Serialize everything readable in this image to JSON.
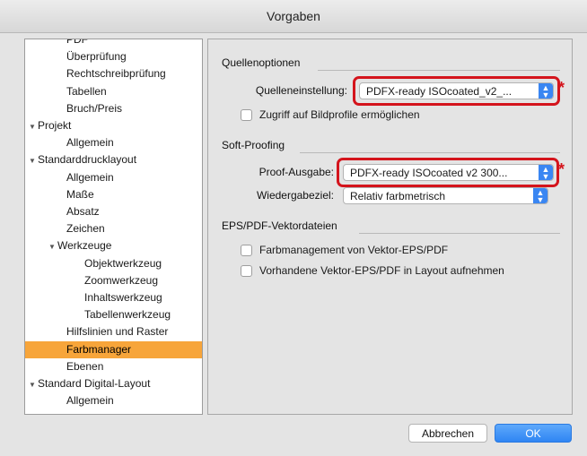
{
  "window": {
    "title": "Vorgaben"
  },
  "tree": {
    "items": [
      {
        "label": "PDF",
        "indent": 2,
        "collapsible": false,
        "selected": false
      },
      {
        "label": "Überprüfung",
        "indent": 2,
        "collapsible": false,
        "selected": false
      },
      {
        "label": "Rechtschreibprüfung",
        "indent": 2,
        "collapsible": false,
        "selected": false
      },
      {
        "label": "Tabellen",
        "indent": 2,
        "collapsible": false,
        "selected": false
      },
      {
        "label": "Bruch/Preis",
        "indent": 2,
        "collapsible": false,
        "selected": false
      },
      {
        "label": "Projekt",
        "indent": 0,
        "collapsible": true,
        "selected": false
      },
      {
        "label": "Allgemein",
        "indent": 2,
        "collapsible": false,
        "selected": false
      },
      {
        "label": "Standarddrucklayout",
        "indent": 0,
        "collapsible": true,
        "selected": false
      },
      {
        "label": "Allgemein",
        "indent": 2,
        "collapsible": false,
        "selected": false
      },
      {
        "label": "Maße",
        "indent": 2,
        "collapsible": false,
        "selected": false
      },
      {
        "label": "Absatz",
        "indent": 2,
        "collapsible": false,
        "selected": false
      },
      {
        "label": "Zeichen",
        "indent": 2,
        "collapsible": false,
        "selected": false
      },
      {
        "label": "Werkzeuge",
        "indent": 1,
        "collapsible": true,
        "selected": false
      },
      {
        "label": "Objektwerkzeug",
        "indent": 3,
        "collapsible": false,
        "selected": false
      },
      {
        "label": "Zoomwerkzeug",
        "indent": 3,
        "collapsible": false,
        "selected": false
      },
      {
        "label": "Inhaltswerkzeug",
        "indent": 3,
        "collapsible": false,
        "selected": false
      },
      {
        "label": "Tabellenwerkzeug",
        "indent": 3,
        "collapsible": false,
        "selected": false
      },
      {
        "label": "Hilfslinien und Raster",
        "indent": 2,
        "collapsible": false,
        "selected": false
      },
      {
        "label": "Farbmanager",
        "indent": 2,
        "collapsible": false,
        "selected": true
      },
      {
        "label": "Ebenen",
        "indent": 2,
        "collapsible": false,
        "selected": false
      },
      {
        "label": "Standard Digital-Layout",
        "indent": 0,
        "collapsible": true,
        "selected": false
      },
      {
        "label": "Allgemein",
        "indent": 2,
        "collapsible": false,
        "selected": false
      }
    ]
  },
  "sections": {
    "quelle": {
      "title": "Quellenoptionen",
      "einstellung_label": "Quelleneinstellung:",
      "einstellung_value": "PDFX-ready ISOcoated_v2_...",
      "bildprofile_label": "Zugriff auf Bildprofile ermöglichen",
      "bildprofile_checked": false
    },
    "softproof": {
      "title": "Soft-Proofing",
      "ausgabe_label": "Proof-Ausgabe:",
      "ausgabe_value": "PDFX-ready ISOcoated v2 300...",
      "wiedergabe_label": "Wiedergabeziel:",
      "wiedergabe_value": "Relativ farbmetrisch"
    },
    "eps": {
      "title": "EPS/PDF-Vektordateien",
      "farbmanagement_label": "Farbmanagement von Vektor-EPS/PDF",
      "farbmanagement_checked": false,
      "aufnehmen_label": "Vorhandene Vektor-EPS/PDF in Layout aufnehmen",
      "aufnehmen_checked": false
    }
  },
  "annotations": {
    "marker": "*",
    "color": "#d4141c"
  },
  "buttons": {
    "cancel": "Abbrechen",
    "ok": "OK"
  },
  "colors": {
    "selection": "#f7a53a",
    "accent": "#3a86f2",
    "highlight": "#d4141c"
  }
}
